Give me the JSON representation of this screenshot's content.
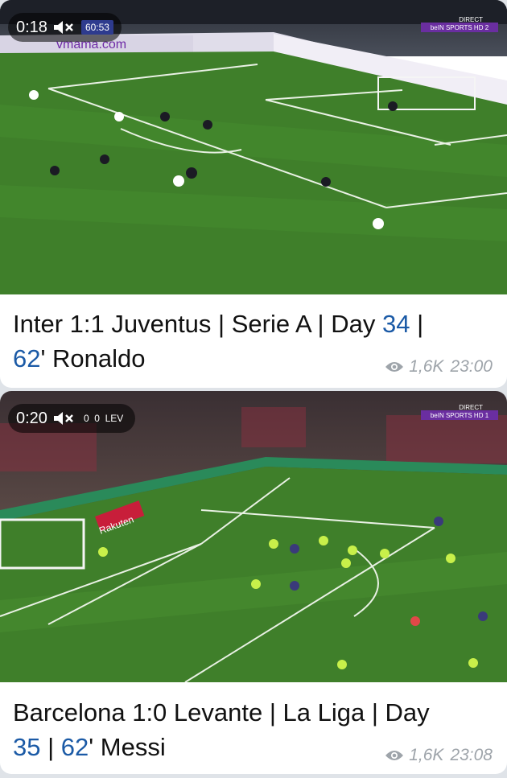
{
  "posts": [
    {
      "duration": "0:18",
      "score_overlay": "60:53",
      "broadcaster": "beIN SPORTS HD 2",
      "broadcaster_tag": "DIRECT",
      "ad_text": "vmama.com",
      "caption_parts": [
        "Inter 1:1 Juventus | Serie A | Day ",
        "34",
        " |",
        "62",
        "' Ronaldo"
      ],
      "views": "1,6K",
      "time": "23:00"
    },
    {
      "duration": "0:20",
      "score_overlay": "0  0  LEV",
      "broadcaster": "beIN SPORTS HD 1",
      "broadcaster_tag": "DIRECT",
      "ad_text": "Rakuten",
      "caption_parts": [
        "Barcelona 1:0 Levante | La Liga | Day",
        "35",
        " | ",
        "62",
        "' Messi"
      ],
      "views": "1,6K",
      "time": "23:08"
    }
  ],
  "icons": {
    "mute": "speaker-muted-icon",
    "views": "eye-icon"
  },
  "colors": {
    "accent": "#1b5aa6",
    "meta": "#9ea4aa",
    "pitch": "#3f7f2a"
  }
}
